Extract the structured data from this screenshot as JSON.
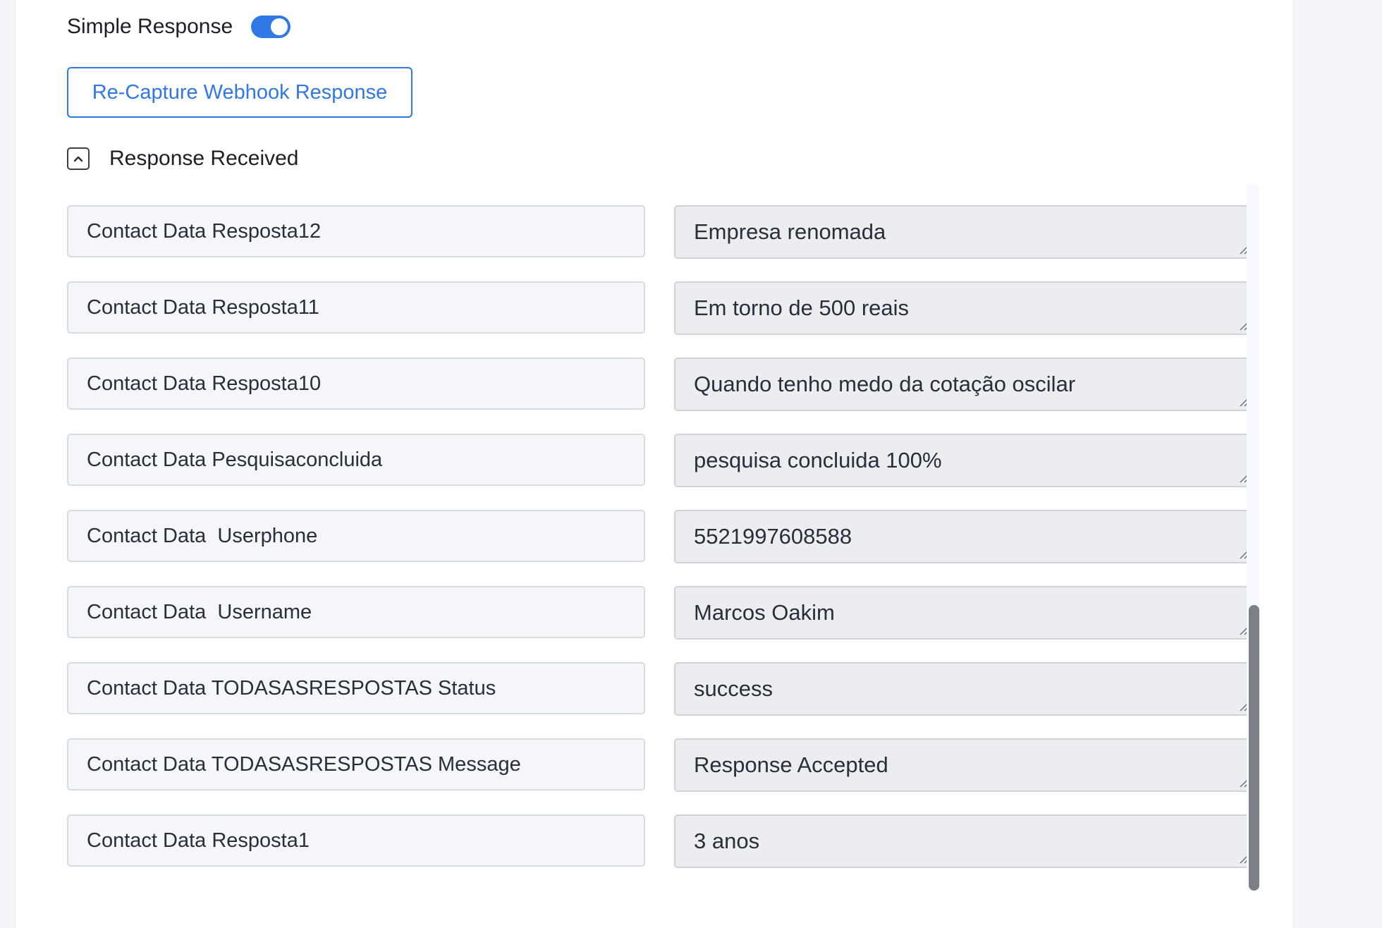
{
  "header": {
    "simple_response_label": "Simple Response",
    "simple_response_enabled": true,
    "recapture_button_label": "Re-Capture Webhook Response",
    "response_received_label": "Response Received"
  },
  "response_rows": [
    {
      "key": "Contact Data Resposta12",
      "value": "Empresa renomada"
    },
    {
      "key": "Contact Data Resposta11",
      "value": "Em torno de 500 reais"
    },
    {
      "key": "Contact Data Resposta10",
      "value": "Quando tenho medo da cotação oscilar"
    },
    {
      "key": "Contact Data Pesquisaconcluida",
      "value": "pesquisa concluida 100%"
    },
    {
      "key": "Contact Data  Userphone",
      "value": "5521997608588"
    },
    {
      "key": "Contact Data  Username",
      "value": "Marcos Oakim"
    },
    {
      "key": "Contact Data TODASASRESPOSTAS Status",
      "value": "success"
    },
    {
      "key": "Contact Data TODASASRESPOSTAS Message",
      "value": "Response Accepted"
    },
    {
      "key": "Contact Data Resposta1",
      "value": "3 anos"
    }
  ],
  "colors": {
    "accent": "#2f78e6",
    "key_field_bg": "#f4f6f9",
    "value_field_bg": "#ecedf0",
    "scroll_thumb": "#7b8087"
  },
  "icons": {
    "collapse": "chevron-up-icon",
    "resize": "resize-grip-icon"
  }
}
